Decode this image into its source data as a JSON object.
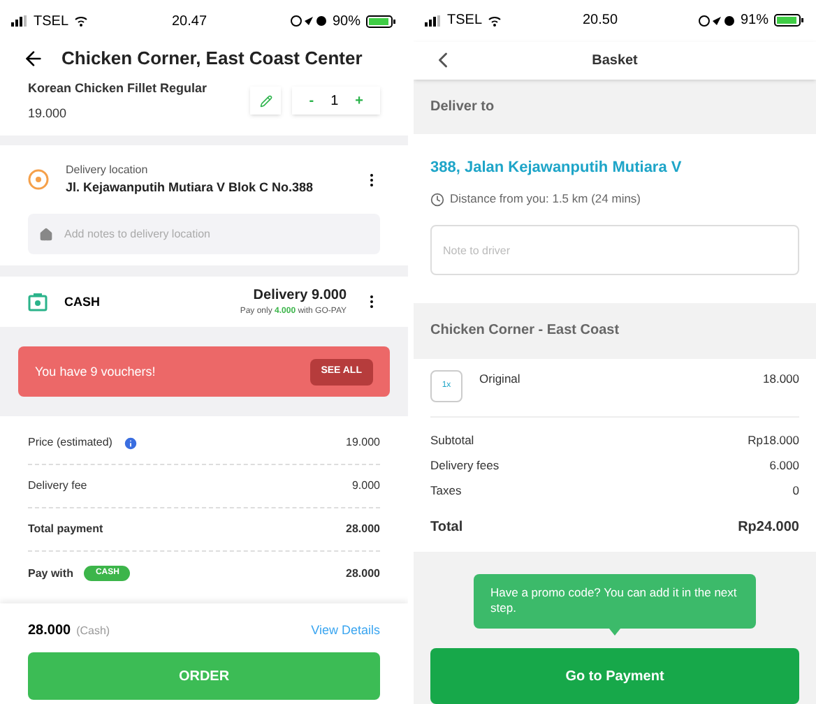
{
  "left_screen": {
    "status_bar": {
      "carrier": "TSEL",
      "time": "20.47",
      "battery": "90%"
    },
    "header": {
      "title": "Chicken Corner, East Coast Center"
    },
    "item": {
      "name": "Korean Chicken Fillet Regular",
      "price": "19.000",
      "quantity": "1",
      "minus": "-",
      "plus": "+"
    },
    "delivery": {
      "label": "Delivery location",
      "address": "Jl. Kejawanputih Mutiara V Blok C No.388",
      "notes_placeholder": "Add notes to delivery location"
    },
    "payment": {
      "method": "CASH",
      "delivery": "Delivery 9.000",
      "promo": "Pay only **4.000** with GO-PAY"
    },
    "voucher": {
      "text": "You have 9 vouchers!",
      "button": "SEE ALL"
    },
    "summary": [
      {
        "kind": "info",
        "label": "Price (estimated)",
        "value": "19.000"
      },
      {
        "kind": "plain",
        "label": "Delivery fee",
        "value": "9.000"
      },
      {
        "kind": "bold",
        "label": "Total payment",
        "value": "28.000"
      },
      {
        "kind": "badge",
        "label": "Pay with",
        "badge": "CASH",
        "value": "28.000"
      }
    ],
    "footer": {
      "total": "28.000",
      "note": "(Cash)",
      "link": "View Details",
      "button": "ORDER"
    }
  },
  "right_screen": {
    "status_bar": {
      "carrier": "TSEL",
      "time": "20.50",
      "battery": "91%"
    },
    "header": {
      "title": "Basket"
    },
    "deliver_section": "Deliver to",
    "address": "388, Jalan Kejawanputih Mutiara V",
    "distance": "Distance from you: 1.5 km (24 mins)",
    "note_placeholder": "Note to driver",
    "restaurant": "Chicken Corner - East Coast",
    "item": {
      "quantity": "1x",
      "name": "Original",
      "price": "18.000"
    },
    "summary": [
      {
        "label": "Subtotal",
        "value": "Rp18.000"
      },
      {
        "label": "Delivery fees",
        "value": "6.000"
      },
      {
        "label": "Taxes",
        "value": "0"
      }
    ],
    "total": {
      "label": "Total",
      "value": "Rp24.000"
    },
    "tooltip": "Have a promo code? You can add it in the next step.",
    "button": "Go to Payment"
  }
}
